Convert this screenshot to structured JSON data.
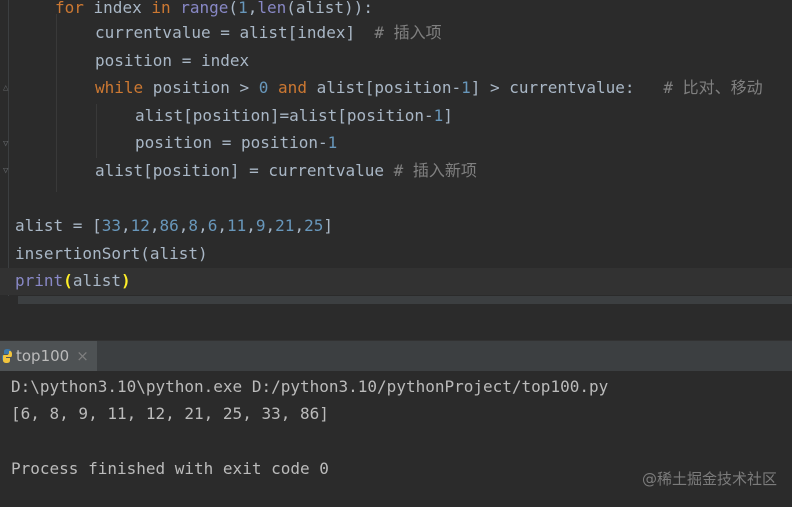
{
  "editor": {
    "lines": {
      "l0": {
        "for_kw": "for",
        "rest": " index ",
        "in_kw": "in",
        "sp": " ",
        "range_fn": "range",
        "open": "(",
        "one": "1",
        "comma": ",",
        "len_fn": "len",
        "tail": "(alist)):"
      },
      "l1": {
        "code": "currentvalue = alist[index]",
        "comment": "  # 插入项"
      },
      "l2": {
        "code": "position = index"
      },
      "l3": {
        "while_kw": "while",
        "a": " position > ",
        "zero": "0",
        "b": " ",
        "and_kw": "and",
        "c": " alist[position-",
        "one": "1",
        "d": "] > currentvalue:",
        "comment": "   # 比对、移动"
      },
      "l4": {
        "a": "alist[position]=alist[position-",
        "one": "1",
        "b": "]"
      },
      "l5": {
        "a": "position = position-",
        "one": "1"
      },
      "l6": {
        "code": "alist[position] = currentvalue",
        "comment": " # 插入新项"
      },
      "l8": {
        "a": "alist = [",
        "nums": [
          "33",
          "12",
          "86",
          "8",
          "6",
          "11",
          "9",
          "21",
          "25"
        ],
        "sep": ",",
        "b": "]"
      },
      "l9": {
        "code": "insertionSort(alist)"
      },
      "l10": {
        "print_fn": "print",
        "open": "(",
        "arg": "alist",
        "close": ")"
      }
    }
  },
  "run_panel": {
    "tab_label": "top100",
    "close_glyph": "×"
  },
  "console": {
    "line1": "D:\\python3.10\\python.exe D:/python3.10/pythonProject/top100.py",
    "line2": "[6, 8, 9, 11, 12, 21, 25, 33, 86]",
    "line3": "",
    "line4": "Process finished with exit code 0"
  },
  "watermark": "@稀土掘金技术社区",
  "colors": {
    "background": "#2b2b2b",
    "keyword": "#cc7832",
    "number": "#6897bb",
    "comment": "#808080",
    "builtin": "#8888c6",
    "text": "#a9b7c6"
  }
}
